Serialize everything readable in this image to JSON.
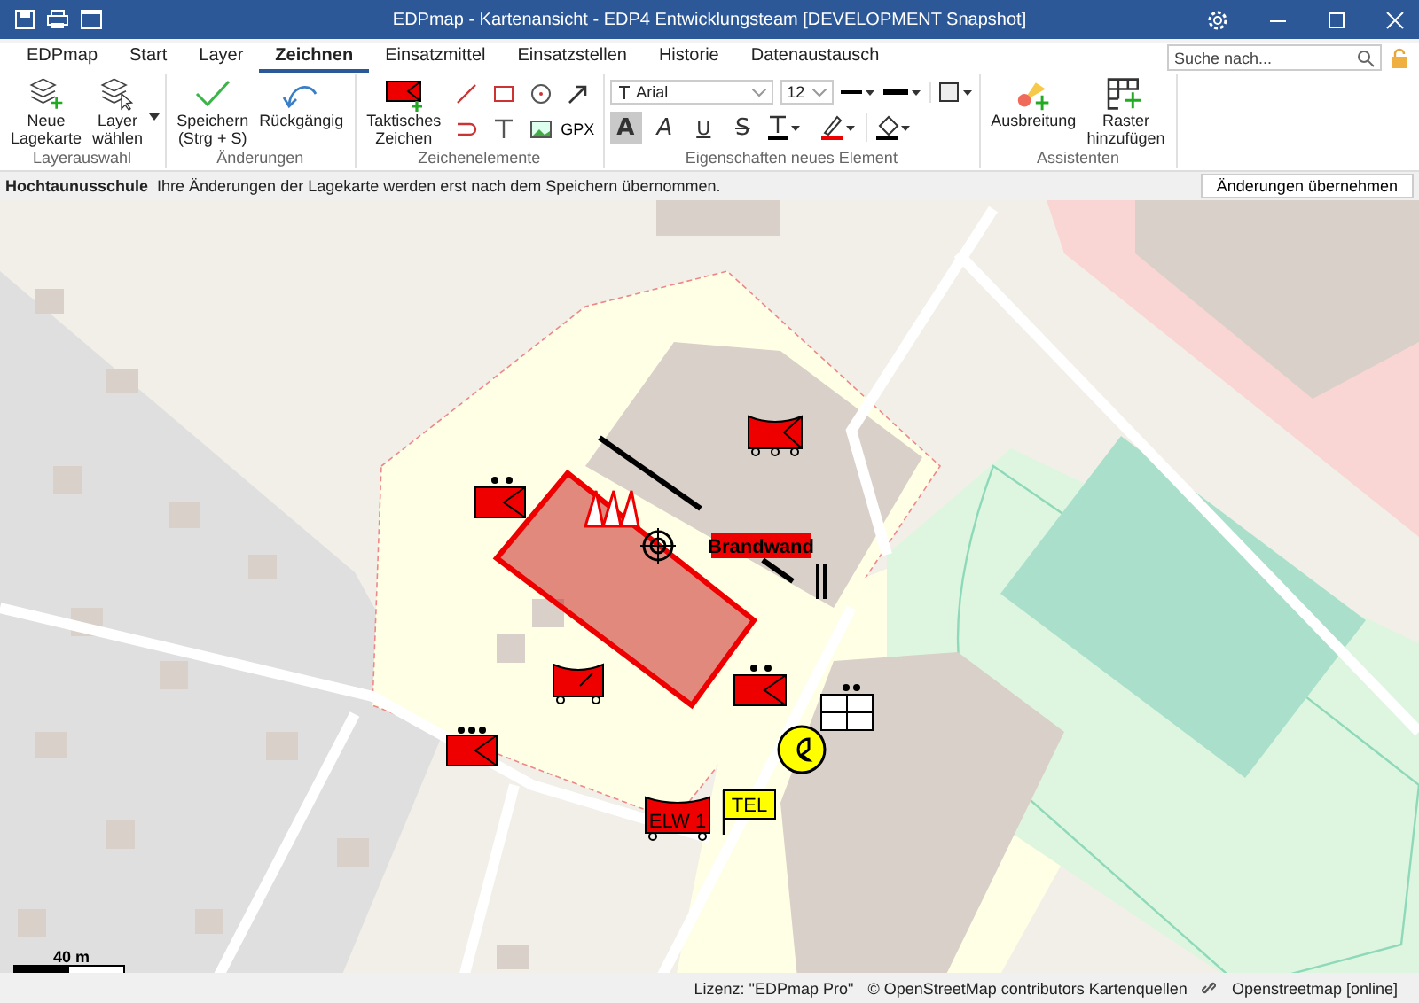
{
  "window": {
    "title": "EDPmap - Kartenansicht - EDP4 Entwicklungsteam  [DEVELOPMENT Snapshot]"
  },
  "tabs": [
    {
      "label": "EDPmap",
      "selected": false
    },
    {
      "label": "Start",
      "selected": false
    },
    {
      "label": "Layer",
      "selected": false
    },
    {
      "label": "Zeichnen",
      "selected": true
    },
    {
      "label": "Einsatzmittel",
      "selected": false
    },
    {
      "label": "Einsatzstellen",
      "selected": false
    },
    {
      "label": "Historie",
      "selected": false
    },
    {
      "label": "Datenaustausch",
      "selected": false
    }
  ],
  "search": {
    "placeholder": "Suche nach..."
  },
  "ribbon": {
    "layer_group": {
      "label": "Layerauswahl",
      "new_map": "Neue\nLagekarte",
      "choose_layer": "Layer\nwählen"
    },
    "changes_group": {
      "label": "Änderungen",
      "save": "Speichern\n(Strg + S)",
      "undo": "Rückgängig"
    },
    "elements_group": {
      "label": "Zeichenelemente",
      "tactical": "Taktisches\nZeichen",
      "gpx": "GPX"
    },
    "properties_group": {
      "label": "Eigenschaften neues Element",
      "font": "Arial",
      "size": "12",
      "styles": [
        {
          "label": "A",
          "kind": "bold",
          "selected": true
        },
        {
          "label": "A",
          "kind": "italic",
          "selected": false
        },
        {
          "label": "U",
          "kind": "underline",
          "selected": false
        },
        {
          "label": "S",
          "kind": "strike",
          "selected": false
        }
      ]
    },
    "assistants_group": {
      "label": "Assistenten",
      "spread": "Ausbreitung",
      "grid": "Raster\nhinzufügen"
    }
  },
  "info_bar": {
    "title": "Hochtaunusschule",
    "message": "Ihre Änderungen der Lagekarte werden erst nach dem Speichern übernommen.",
    "button": "Änderungen übernehmen"
  },
  "map": {
    "fire_wall_label": "Brandwand",
    "command_vehicle_label": "ELW 1",
    "flag_label": "TEL",
    "scale_label": "40 m"
  },
  "status_bar": {
    "license": "Lizenz: \"EDPmap Pro\"",
    "attribution": "© OpenStreetMap contributors Kartenquellen",
    "source": "Openstreetmap [online]"
  }
}
